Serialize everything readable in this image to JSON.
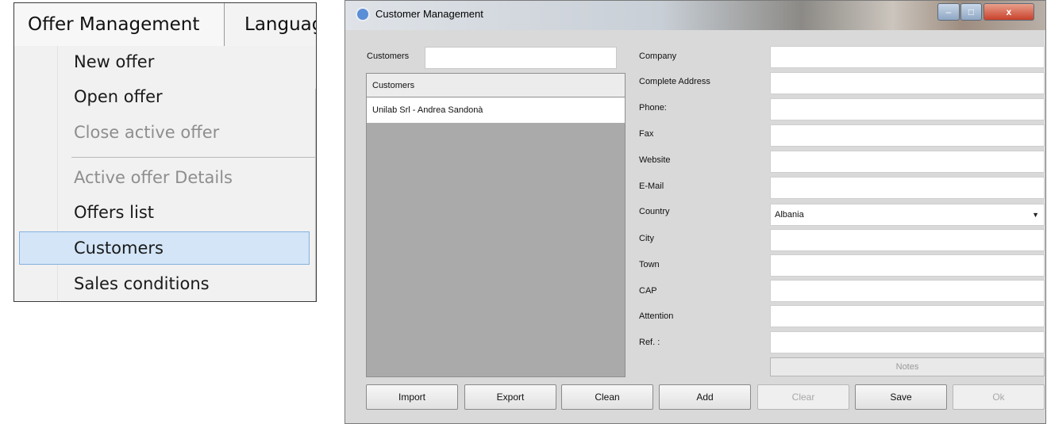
{
  "menu": {
    "tabs": [
      "Offer Management",
      "Languag"
    ],
    "items": [
      {
        "label": "New offer",
        "disabled": false
      },
      {
        "label": "Open offer",
        "disabled": false
      },
      {
        "label": "Close active offer",
        "disabled": true
      },
      {
        "label": "Active offer Details",
        "disabled": true
      },
      {
        "label": "Offers list",
        "disabled": false
      },
      {
        "label": "Customers",
        "disabled": false,
        "highlighted": true
      },
      {
        "label": "Sales conditions",
        "disabled": false
      }
    ]
  },
  "window": {
    "title": "Customer Management",
    "controls": {
      "minimize": "–",
      "maximize": "□",
      "close": "x"
    },
    "search": {
      "label": "Customers",
      "value": ""
    },
    "list": {
      "header": "Customers",
      "rows": [
        "Unilab Srl - Andrea Sandonà"
      ]
    },
    "form": {
      "company": {
        "label": "Company",
        "value": ""
      },
      "address": {
        "label": "Complete Address",
        "value": ""
      },
      "phone": {
        "label": "Phone:",
        "value": ""
      },
      "fax": {
        "label": "Fax",
        "value": ""
      },
      "website": {
        "label": "Website",
        "value": ""
      },
      "email": {
        "label": "E-Mail",
        "value": ""
      },
      "country": {
        "label": "Country",
        "value": "Albania"
      },
      "city": {
        "label": "City",
        "value": ""
      },
      "town": {
        "label": "Town",
        "value": ""
      },
      "cap": {
        "label": "CAP",
        "value": ""
      },
      "attention": {
        "label": "Attention",
        "value": ""
      },
      "ref": {
        "label": "Ref. :",
        "value": ""
      }
    },
    "notes_label": "Notes",
    "buttons": {
      "import": "Import",
      "export": "Export",
      "clean": "Clean",
      "add": "Add",
      "clear": "Clear",
      "save": "Save",
      "ok": "Ok"
    }
  }
}
